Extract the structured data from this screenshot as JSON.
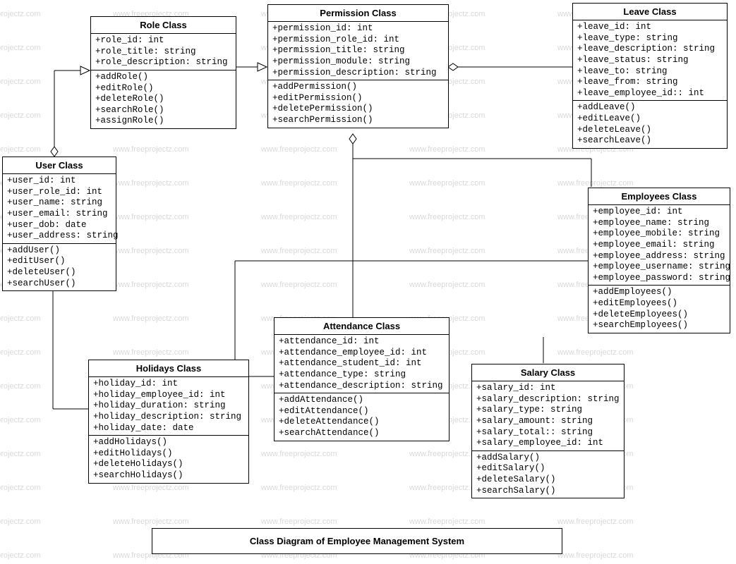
{
  "watermark_text": "www.freeprojectz.com",
  "diagram_title": "Class Diagram of Employee Management System",
  "classes": {
    "role": {
      "title": "Role Class",
      "attrs": [
        "+role_id: int",
        "+role_title: string",
        "+role_description: string"
      ],
      "ops": [
        "+addRole()",
        "+editRole()",
        "+deleteRole()",
        "+searchRole()",
        "+assignRole()"
      ]
    },
    "permission": {
      "title": "Permission Class",
      "attrs": [
        "+permission_id: int",
        "+permission_role_id: int",
        "+permission_title: string",
        "+permission_module: string",
        "+permission_description: string"
      ],
      "ops": [
        "+addPermission()",
        "+editPermission()",
        "+deletePermission()",
        "+searchPermission()"
      ]
    },
    "leave": {
      "title": "Leave Class",
      "attrs": [
        "+leave_id: int",
        "+leave_type: string",
        "+leave_description: string",
        "+leave_status: string",
        "+leave_to: string",
        "+leave_from: string",
        "+leave_employee_id:: int"
      ],
      "ops": [
        "+addLeave()",
        "+editLeave()",
        "+deleteLeave()",
        "+searchLeave()"
      ]
    },
    "user": {
      "title": "User Class",
      "attrs": [
        "+user_id: int",
        "+user_role_id: int",
        "+user_name: string",
        "+user_email: string",
        "+user_dob: date",
        "+user_address: string"
      ],
      "ops": [
        "+addUser()",
        "+editUser()",
        "+deleteUser()",
        "+searchUser()"
      ]
    },
    "employees": {
      "title": "Employees Class",
      "attrs": [
        "+employee_id: int",
        "+employee_name: string",
        "+employee_mobile: string",
        "+employee_email: string",
        "+employee_address: string",
        "+employee_username: string",
        "+employee_password: string"
      ],
      "ops": [
        "+addEmployees()",
        "+editEmployees()",
        "+deleteEmployees()",
        "+searchEmployees()"
      ]
    },
    "holidays": {
      "title": "Holidays Class",
      "attrs": [
        "+holiday_id: int",
        "+holiday_employee_id: int",
        "+holiday_duration: string",
        "+holiday_description: string",
        "+holiday_date: date"
      ],
      "ops": [
        "+addHolidays()",
        "+editHolidays()",
        "+deleteHolidays()",
        "+searchHolidays()"
      ]
    },
    "attendance": {
      "title": "Attendance Class",
      "attrs": [
        "+attendance_id: int",
        "+attendance_employee_id: int",
        "+attendance_student_id: int",
        "+attendance_type: string",
        "+attendance_description: string"
      ],
      "ops": [
        "+addAttendance()",
        "+editAttendance()",
        "+deleteAttendance()",
        "+searchAttendance()"
      ]
    },
    "salary": {
      "title": "Salary Class",
      "attrs": [
        "+salary_id: int",
        "+salary_description: string",
        "+salary_type: string",
        "+salary_amount: string",
        "+salary_total:: string",
        "+salary_employee_id: int"
      ],
      "ops": [
        "+addSalary()",
        "+editSalary()",
        "+deleteSalary()",
        "+searchSalary()"
      ]
    }
  }
}
